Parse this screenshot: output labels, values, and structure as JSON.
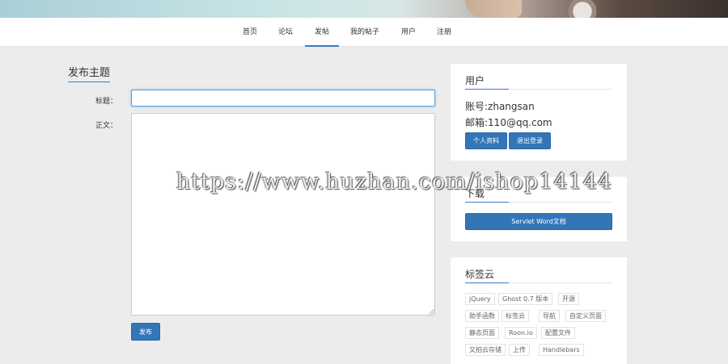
{
  "nav": {
    "items": [
      {
        "label": "首页"
      },
      {
        "label": "论坛"
      },
      {
        "label": "发帖"
      },
      {
        "label": "我的帖子"
      },
      {
        "label": "用户"
      },
      {
        "label": "注册"
      }
    ],
    "active_index": 2
  },
  "form": {
    "section_title": "发布主题",
    "title_label": "标题：",
    "title_value": "",
    "body_label": "正文：",
    "body_value": "",
    "submit_label": "发布"
  },
  "user_panel": {
    "title": "用户",
    "account_line": "账号:zhangsan",
    "email_line": "邮箱:110@qq.com",
    "profile_button": "个人资料",
    "logout_button": "退出登录"
  },
  "download_panel": {
    "title": "下载",
    "button_label": "Servlet Word文档"
  },
  "tag_panel": {
    "title": "标签云",
    "tags": [
      "jQuery",
      "Ghost 0.7 版本",
      "开源",
      "助手函数",
      "标签云",
      "导航",
      "自定义页面",
      "静态页面",
      "Roon.io",
      "配置文件",
      "又拍云存储",
      "上传",
      "Handlebars"
    ]
  },
  "watermark": "https://www.huzhan.com/ishop14144",
  "colors": {
    "accent": "#3276b8",
    "background": "#ececec"
  }
}
